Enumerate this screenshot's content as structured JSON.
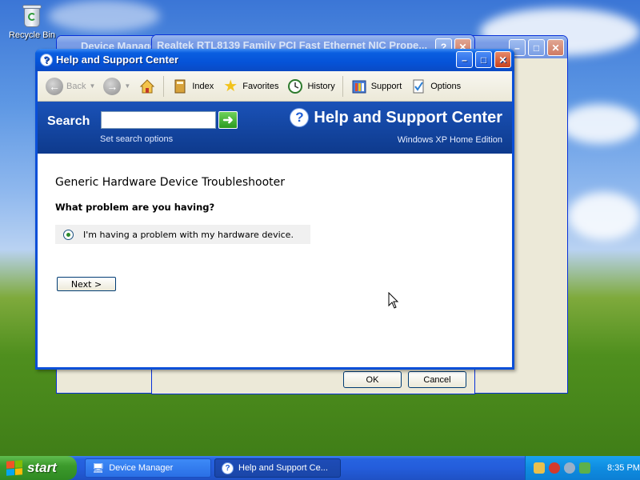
{
  "desktop": {
    "recycle_bin_label": "Recycle Bin"
  },
  "background_windows": {
    "device_manager_title": "Device Manager",
    "nic_properties_title": "Realtek RTL8139 Family PCI Fast Ethernet NIC Prope...",
    "ok_label": "OK",
    "cancel_label": "Cancel"
  },
  "help_window": {
    "title": "Help and Support Center",
    "toolbar": {
      "back": "Back",
      "index": "Index",
      "favorites": "Favorites",
      "history": "History",
      "support": "Support",
      "options": "Options"
    },
    "search": {
      "label": "Search",
      "value": "",
      "set_options": "Set search options"
    },
    "banner": {
      "title": "Help and Support Center",
      "edition": "Windows XP Home Edition"
    },
    "content": {
      "heading": "Generic Hardware Device Troubleshooter",
      "question": "What problem are you having?",
      "option": "I'm having a problem with my hardware device.",
      "option_selected": true,
      "next_label": "Next  >"
    }
  },
  "taskbar": {
    "start_label": "start",
    "items": [
      {
        "label": "Device Manager",
        "icon": "computer-icon",
        "active": false
      },
      {
        "label": "Help and Support Ce...",
        "icon": "help-icon",
        "active": true
      }
    ],
    "clock": "8:35 PM"
  },
  "colors": {
    "title_bar": "#0553d8",
    "banner": "#12439c",
    "start_button": "#3c9a2c",
    "taskbar": "#245ddb"
  }
}
